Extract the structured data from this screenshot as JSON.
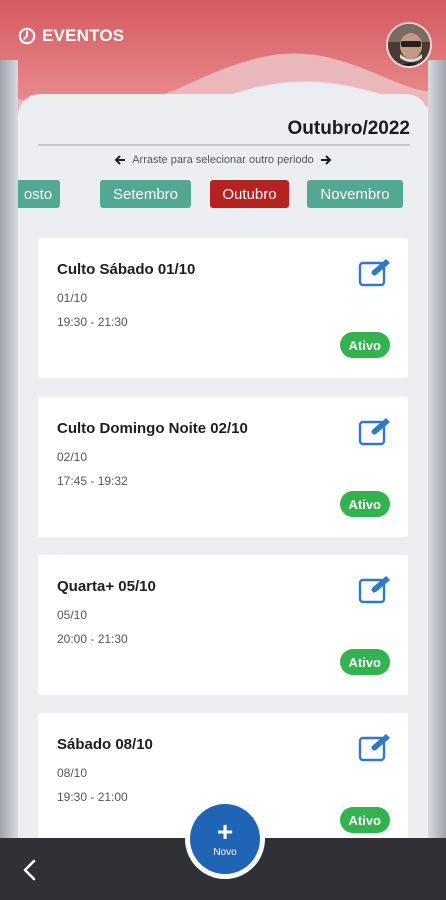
{
  "header": {
    "title": "EVENTOS"
  },
  "period": {
    "title": "Outubro/2022",
    "hint": "Arraste para selecionar outro periodo"
  },
  "months": [
    {
      "label": "osto"
    },
    {
      "label": "Setembro"
    },
    {
      "label": "Outubro",
      "active": true
    },
    {
      "label": "Novembro"
    }
  ],
  "events": [
    {
      "title": "Culto Sábado 01/10",
      "date": "01/10",
      "time": "19:30 - 21:30",
      "status": "Ativo"
    },
    {
      "title": "Culto Domingo Noite 02/10",
      "date": "02/10",
      "time": "17:45 - 19:32",
      "status": "Ativo"
    },
    {
      "title": "Quarta+ 05/10",
      "date": "05/10",
      "time": "20:00 - 21:30",
      "status": "Ativo"
    },
    {
      "title": "Sábado 08/10",
      "date": "08/10",
      "time": "19:30 - 21:00",
      "status": "Ativo"
    }
  ],
  "fab": {
    "icon": "plus",
    "label": "Novo"
  },
  "icons": {
    "header": "clock-icon",
    "edit": "edit-icon",
    "back": "back-arrow-icon"
  },
  "colors": {
    "month_chip": "#52a893",
    "month_chip_active": "#b5221f",
    "status_active": "#33b34f",
    "fab": "#1f64b5",
    "header_gradient": "#e86a6e"
  }
}
